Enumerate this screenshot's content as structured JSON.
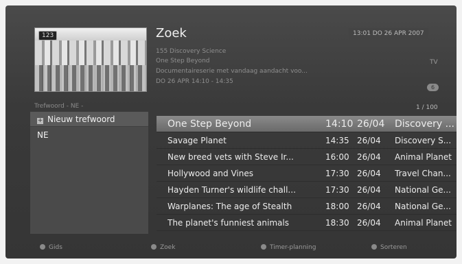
{
  "header": {
    "title": "Zoek",
    "datetime": "13:01 DO 26 APR 2007",
    "channel": "155 Discovery Science",
    "program": "One Step Beyond",
    "description": "Documentaireserie met vandaag aandacht voo...",
    "airtime": "DO 26 APR 14:10 - 14:35",
    "type": "TV",
    "age_rating": "6"
  },
  "thumbnail": {
    "channel_number": "123"
  },
  "keywords": {
    "header": "Trefwoord - NE -",
    "items": [
      {
        "label": "Nieuw trefwoord",
        "icon": "plus-icon"
      },
      {
        "label": "NE"
      }
    ]
  },
  "results": {
    "page": "1 / 100",
    "rows": [
      {
        "title": "One Step Beyond",
        "time": "14:10",
        "date": "26/04",
        "channel": "Discovery ..."
      },
      {
        "title": "Savage Planet",
        "time": "14:35",
        "date": "26/04",
        "channel": "Discovery S..."
      },
      {
        "title": "New breed vets with Steve Ir...",
        "time": "16:00",
        "date": "26/04",
        "channel": "Animal Planet"
      },
      {
        "title": "Hollywood and Vines",
        "time": "17:30",
        "date": "26/04",
        "channel": "Travel Chan..."
      },
      {
        "title": "Hayden Turner's wildlife chall...",
        "time": "17:30",
        "date": "26/04",
        "channel": "National Ge..."
      },
      {
        "title": "Warplanes: The age of Stealth",
        "time": "18:00",
        "date": "26/04",
        "channel": "National Ge..."
      },
      {
        "title": "The planet's funniest animals",
        "time": "18:30",
        "date": "26/04",
        "channel": "Animal Planet"
      }
    ]
  },
  "footer": {
    "gids": "Gids",
    "zoek": "Zoek",
    "timer": "Timer-planning",
    "sorteren": "Sorteren"
  }
}
